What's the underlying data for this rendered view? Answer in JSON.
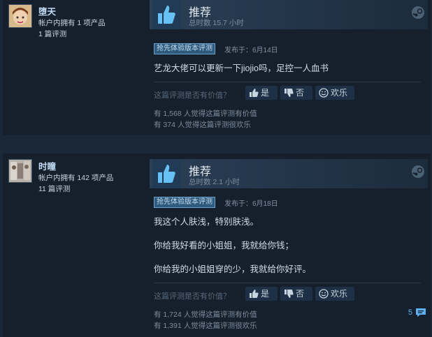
{
  "icons": {
    "recommend": "thumbs-up-icon",
    "steam": "steam-logo-icon",
    "yes": "thumbs-up-icon",
    "no": "thumbs-down-icon",
    "funny": "smiley-icon",
    "comments": "speech-bubble-icon"
  },
  "colors": {
    "page_bg": "#1b2838",
    "card_bg": "#16202d",
    "username": "#c1dbf4",
    "badge_bg": "#2e5a7e",
    "accent": "#5cb0f0"
  },
  "reviews": [
    {
      "username": "堕天",
      "products_owned": "帐户内拥有 1 项产品",
      "reviews_count": "1 篇评测",
      "verdict": "推荐",
      "hours": "总时数 15.7 小时",
      "badge": "抢先体验版本评测",
      "posted": "发布于：6月14日",
      "body": [
        "艺龙大佬可以更新一下jiojio吗，足控一人血书"
      ],
      "helpful_question": "这篇评测是否有价值？",
      "vote_yes": "是",
      "vote_no": "否",
      "vote_funny": "欢乐",
      "helpful_count": "有 1,568 人觉得这篇评测有价值",
      "funny_count": "有 374 人觉得这篇评测很欢乐"
    },
    {
      "username": "时瞳",
      "products_owned": "帐户内拥有 142 项产品",
      "reviews_count": "11 篇评测",
      "verdict": "推荐",
      "hours": "总时数 2.1 小时",
      "badge": "抢先体验版本评测",
      "posted": "发布于：6月18日",
      "body": [
        "我这个人肤浅，特别肤浅。",
        "你给我好看的小姐姐，我就给你钱；",
        "你给我的小姐姐穿的少，我就给你好评。"
      ],
      "helpful_question": "这篇评测是否有价值？",
      "vote_yes": "是",
      "vote_no": "否",
      "vote_funny": "欢乐",
      "helpful_count": "有 1,724 人觉得这篇评测有价值",
      "funny_count": "有 1,391 人觉得这篇评测很欢乐",
      "comment_count": "5"
    }
  ]
}
